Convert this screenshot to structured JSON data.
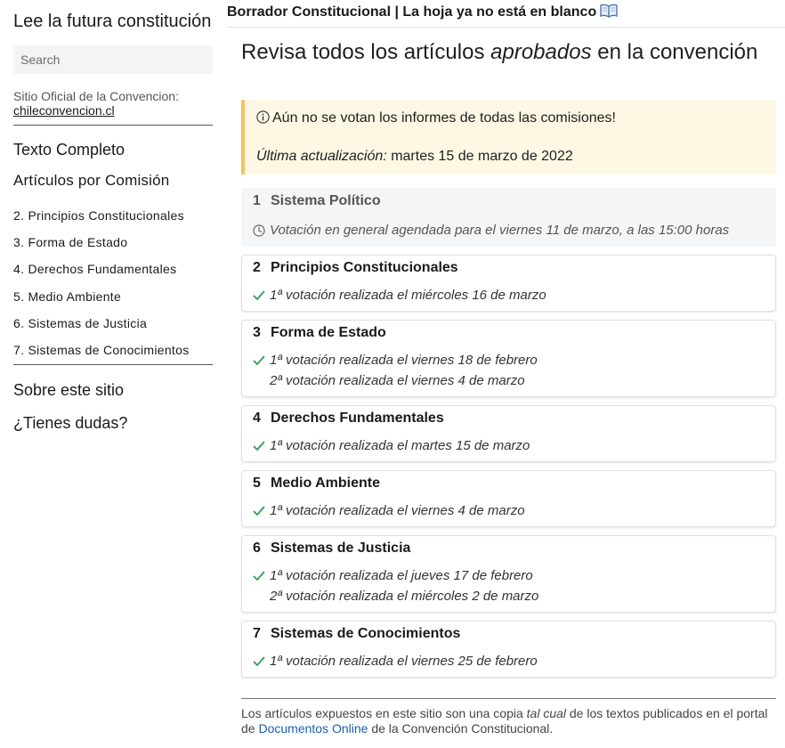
{
  "sidebar": {
    "title": "Lee la futura constitución",
    "search_placeholder": "Search",
    "official_label": "Sitio Oficial de la Convencion:",
    "official_link": "chileconvencion.cl",
    "full_text": "Texto Completo",
    "by_commission": "Artículos por Comisión",
    "commissions": [
      "2. Principios Constitucionales",
      "3. Forma de Estado",
      "4. Derechos Fundamentales",
      "5. Medio Ambiente",
      "6. Sistemas de Justicia",
      "7. Sistemas de Conocimientos"
    ],
    "about": "Sobre este sitio",
    "questions": "¿Tienes dudas?"
  },
  "header": {
    "title": "Borrador Constitucional | La hoja ya no está en blanco",
    "icon": "book-icon"
  },
  "main": {
    "title_before": "Revisa todos los artículos",
    "title_emph": "aprobados",
    "title_after": "en la convención",
    "notice": {
      "icon": "info-icon",
      "message": "Aún no se votan los informes de todas las comisiones!",
      "updated_label": "Última actualización:",
      "updated_value": "martes 15 de marzo de 2022"
    },
    "cards": [
      {
        "num": "1",
        "name": "Sistema Político",
        "status": "pending",
        "votes": [
          "Votación en general agendada para el viernes 11 de marzo, a las 15:00 horas"
        ]
      },
      {
        "num": "2",
        "name": "Principios Constitucionales",
        "status": "done",
        "votes": [
          "1ª votación realizada el miércoles 16 de marzo"
        ]
      },
      {
        "num": "3",
        "name": "Forma de Estado",
        "status": "done",
        "votes": [
          "1ª votación realizada el viernes 18 de febrero",
          "2ª votación realizada el viernes 4 de marzo"
        ]
      },
      {
        "num": "4",
        "name": "Derechos Fundamentales",
        "status": "done",
        "votes": [
          "1ª votación realizada el martes 15 de marzo"
        ]
      },
      {
        "num": "5",
        "name": "Medio Ambiente",
        "status": "done",
        "votes": [
          "1ª votación realizada el viernes 4 de marzo"
        ]
      },
      {
        "num": "6",
        "name": "Sistemas de Justicia",
        "status": "done",
        "votes": [
          "1ª votación realizada el jueves 17 de febrero",
          "2ª votación realizada el miércoles 2 de marzo"
        ]
      },
      {
        "num": "7",
        "name": "Sistemas de Conocimientos",
        "status": "done",
        "votes": [
          "1ª votación realizada el viernes 25 de febrero"
        ]
      }
    ],
    "footer": {
      "text_1": "Los artículos expuestos en este sitio son una copia",
      "text_emph": "tal cual",
      "text_2": "de los textos publicados en el portal de",
      "link": "Documentos Online",
      "text_3": "de la Convención Constitucional."
    }
  },
  "colors": {
    "check": "#2e9e4f",
    "notice_bg": "#fdf7e4",
    "notice_border": "#f0c662",
    "link": "#1a5fb4"
  }
}
